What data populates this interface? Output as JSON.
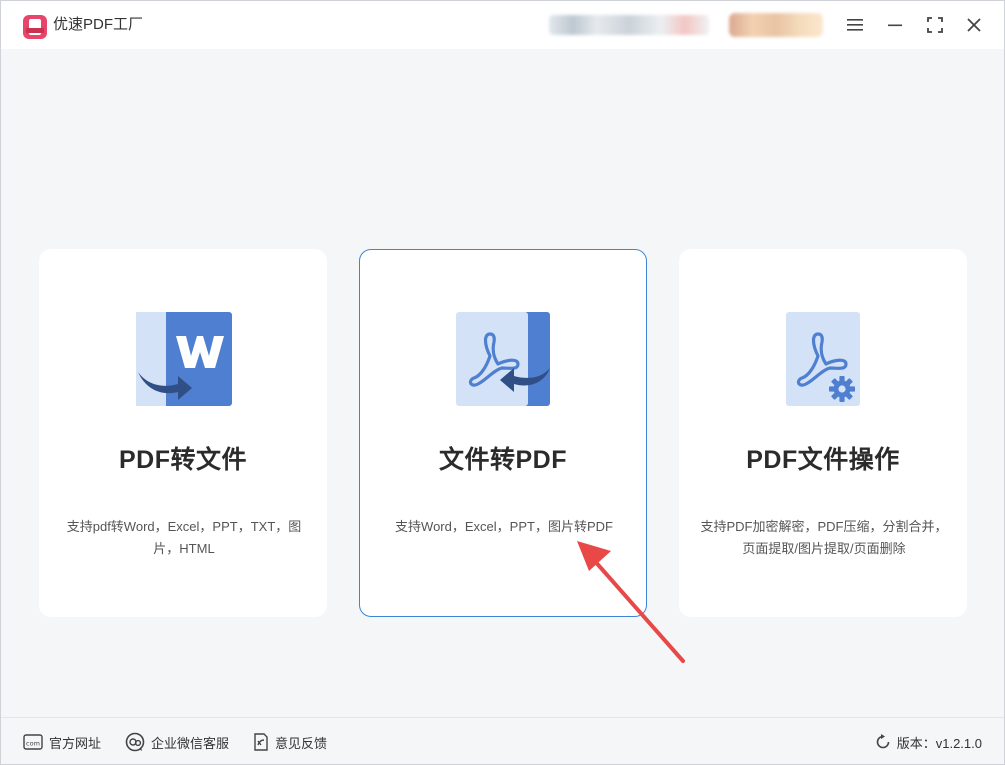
{
  "window": {
    "title": "优速PDF工厂"
  },
  "cards": [
    {
      "id": "pdf-to-file",
      "title": "PDF转文件",
      "description": "支持pdf转Word，Excel，PPT，TXT，图片，HTML",
      "icon": "word-convert-icon",
      "selected": false
    },
    {
      "id": "file-to-pdf",
      "title": "文件转PDF",
      "description": "支持Word，Excel，PPT，图片转PDF",
      "icon": "pdf-convert-icon",
      "selected": true
    },
    {
      "id": "pdf-operations",
      "title": "PDF文件操作",
      "description": "支持PDF加密解密，PDF压缩，分割合并，页面提取/图片提取/页面删除",
      "icon": "pdf-settings-icon",
      "selected": false
    }
  ],
  "footer": {
    "website_label": "官方网址",
    "wechat_label": "企业微信客服",
    "feedback_label": "意见反馈",
    "version_label": "版本：v1.2.1.0"
  },
  "colors": {
    "accent_border": "#3b86d6",
    "icon_dark_blue": "#4f7fd1",
    "icon_light_blue": "#d4e2f7",
    "logo_pink": "#e8456b",
    "annotation_red": "#e84848"
  },
  "icons": {
    "menu": "hamburger-icon",
    "minimize": "minimize-icon",
    "maximize": "fullscreen-icon",
    "close": "close-icon",
    "website": "website-icon",
    "wechat": "wechat-service-icon",
    "feedback": "feedback-icon",
    "version": "refresh-icon"
  }
}
